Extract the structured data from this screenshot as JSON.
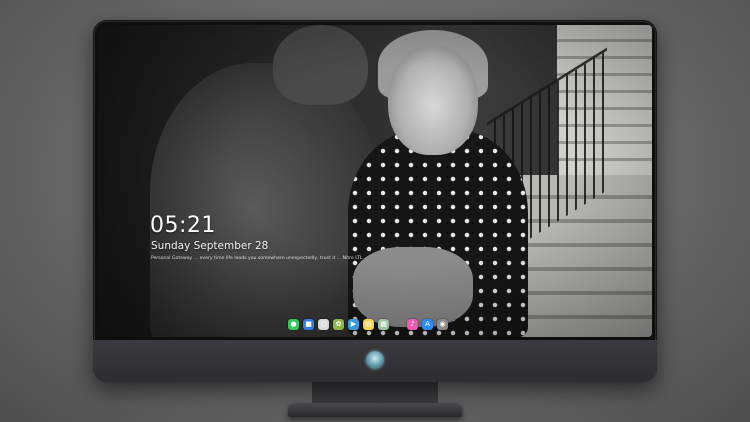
{
  "lock_screen": {
    "time": "05:21",
    "date": "Sunday September  28",
    "quote": "Personal Gateway ... every time life leads you somewhere unexpectedly, trust it ... Nitro LTL"
  },
  "dock": {
    "items": [
      {
        "name": "messages-icon",
        "glyph": "●",
        "color": "#35c759"
      },
      {
        "name": "finder-icon",
        "glyph": "■",
        "color": "#2f7fe0"
      },
      {
        "name": "clock-app-icon",
        "glyph": "◷",
        "color": "#d9d9d9"
      },
      {
        "name": "photos-app-icon",
        "glyph": "✿",
        "color": "#8fb84a"
      },
      {
        "name": "media-app-icon",
        "glyph": "▶",
        "color": "#3a9ad9"
      },
      {
        "name": "notes-icon",
        "glyph": "▤",
        "color": "#f7d24a"
      },
      {
        "name": "files-icon",
        "glyph": "▦",
        "color": "#9fc3a0"
      },
      {
        "name": "music-icon",
        "glyph": "♪",
        "color": "#f05ab0"
      },
      {
        "name": "app-store-icon",
        "glyph": "A",
        "color": "#2d8cf0"
      },
      {
        "name": "camera-icon",
        "glyph": "◉",
        "color": "#8a8a8a"
      }
    ]
  },
  "colors": {
    "screen_text": "#ffffff",
    "bezel": "#0e0e0e",
    "chin": "#2e2d31",
    "logo_accent": "#6fa7b7"
  }
}
